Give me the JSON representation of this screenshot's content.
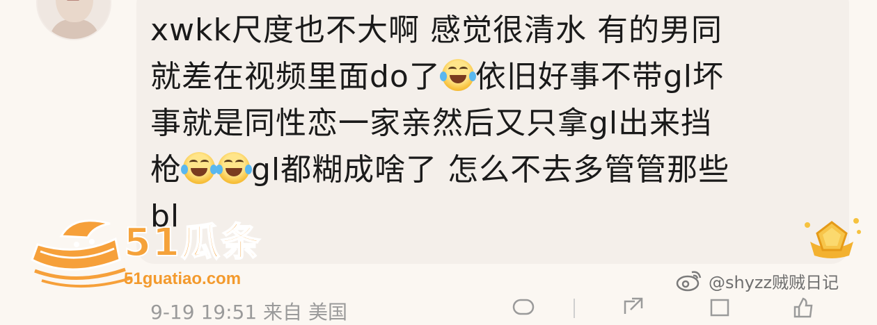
{
  "comment": {
    "line1": "xwkk尺度也不大啊 感觉很清水 有的男同",
    "line2_a": "就差在视频里面do了",
    "line2_b": "依旧好事不带gl坏",
    "line3": "事就是同性恋一家亲然后又只拿gl出来挡",
    "line4_a": "枪",
    "line4_b": "gl都糊成啥了 怎么不去多管管那些",
    "line5": "bl",
    "emoji_icon": "laugh-cry-emoji"
  },
  "watermark": {
    "brand": "51瓜条",
    "url": "51guatiao.com"
  },
  "weibo_watermark": {
    "handle": "@shyzz贼贼日记"
  },
  "footer": {
    "meta": "9-19 19:51 来自 美国"
  },
  "colors": {
    "bubble": "#f4efea",
    "text": "#1a1a1a",
    "brand_orange": "#f5a23a",
    "meta_gray": "#9a9a9a"
  }
}
